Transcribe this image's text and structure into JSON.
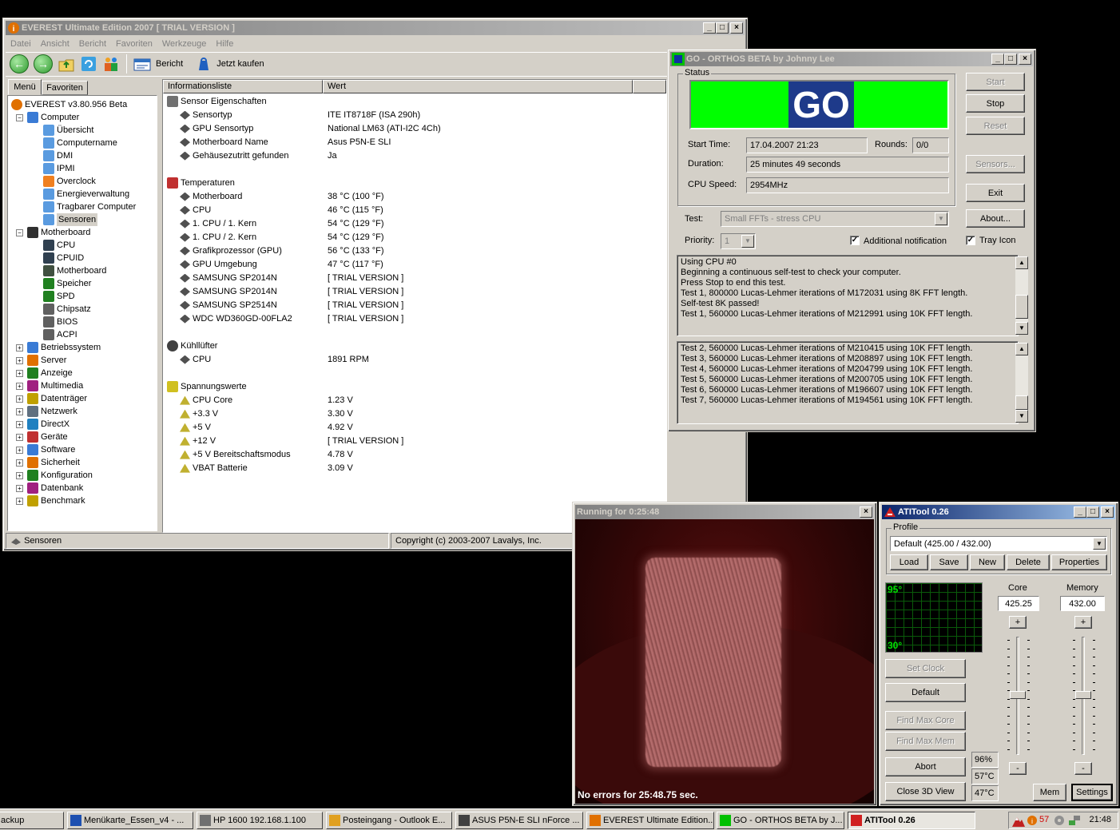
{
  "everest": {
    "title": "EVEREST Ultimate Edition 2007  [ TRIAL VERSION ]",
    "menu": [
      "Datei",
      "Ansicht",
      "Bericht",
      "Favoriten",
      "Werkzeuge",
      "Hilfe"
    ],
    "toolbar": {
      "report": "Bericht",
      "buy": "Jetzt kaufen"
    },
    "tabs": {
      "menu": "Menü",
      "favorites": "Favoriten"
    },
    "tree": {
      "root": "EVEREST v3.80.956 Beta",
      "computer": "Computer",
      "computer_items": [
        "Übersicht",
        "Computername",
        "DMI",
        "IPMI",
        "Overclock",
        "Energieverwaltung",
        "Tragbarer Computer",
        "Sensoren"
      ],
      "motherboard": "Motherboard",
      "motherboard_items": [
        "CPU",
        "CPUID",
        "Motherboard",
        "Speicher",
        "SPD",
        "Chipsatz",
        "BIOS",
        "ACPI"
      ],
      "other_items": [
        "Betriebssystem",
        "Server",
        "Anzeige",
        "Multimedia",
        "Datenträger",
        "Netzwerk",
        "DirectX",
        "Geräte",
        "Software",
        "Sicherheit",
        "Konfiguration",
        "Datenbank",
        "Benchmark"
      ]
    },
    "columns": {
      "field": "Informationsliste",
      "value": "Wert"
    },
    "sections": {
      "sensor": {
        "title": "Sensor Eigenschaften",
        "rows": [
          {
            "field": "Sensortyp",
            "value": "ITE IT8718F  (ISA 290h)"
          },
          {
            "field": "GPU Sensortyp",
            "value": "National LM63  (ATI-I2C 4Ch)"
          },
          {
            "field": "Motherboard Name",
            "value": "Asus P5N-E SLI"
          },
          {
            "field": "Gehäusezutritt gefunden",
            "value": "Ja"
          }
        ]
      },
      "temps": {
        "title": "Temperaturen",
        "rows": [
          {
            "field": "Motherboard",
            "value": "38 °C  (100 °F)"
          },
          {
            "field": "CPU",
            "value": "46 °C  (115 °F)"
          },
          {
            "field": "1. CPU / 1. Kern",
            "value": "54 °C  (129 °F)"
          },
          {
            "field": "1. CPU / 2. Kern",
            "value": "54 °C  (129 °F)"
          },
          {
            "field": "Grafikprozessor (GPU)",
            "value": "56 °C  (133 °F)"
          },
          {
            "field": "GPU Umgebung",
            "value": "47 °C  (117 °F)"
          },
          {
            "field": "SAMSUNG SP2014N",
            "value": "[ TRIAL VERSION ]"
          },
          {
            "field": "SAMSUNG SP2014N",
            "value": "[ TRIAL VERSION ]"
          },
          {
            "field": "SAMSUNG SP2514N",
            "value": "[ TRIAL VERSION ]"
          },
          {
            "field": "WDC WD360GD-00FLA2",
            "value": "[ TRIAL VERSION ]"
          }
        ]
      },
      "fans": {
        "title": "Kühllüfter",
        "rows": [
          {
            "field": "CPU",
            "value": "1891 RPM"
          }
        ]
      },
      "volts": {
        "title": "Spannungswerte",
        "rows": [
          {
            "field": "CPU Core",
            "value": "1.23 V"
          },
          {
            "field": "+3.3 V",
            "value": "3.30 V"
          },
          {
            "field": "+5 V",
            "value": "4.92 V"
          },
          {
            "field": "+12 V",
            "value": "[ TRIAL VERSION ]"
          },
          {
            "field": "+5 V Bereitschaftsmodus",
            "value": "4.78 V"
          },
          {
            "field": "VBAT Batterie",
            "value": "3.09 V"
          }
        ]
      }
    },
    "statusbar": {
      "left": "Sensoren",
      "right": "Copyright (c) 2003-2007 Lavalys, Inc."
    }
  },
  "orthos": {
    "title": "GO - ORTHOS BETA by Johnny Lee",
    "status_label": "Status",
    "go_text": "GO",
    "start_time_label": "Start Time:",
    "start_time": "17.04.2007 21:23",
    "rounds_label": "Rounds:",
    "rounds": "0/0",
    "duration_label": "Duration:",
    "duration": "25 minutes 49 seconds",
    "cpu_speed_label": "CPU Speed:",
    "cpu_speed": "2954MHz",
    "test_label": "Test:",
    "test_value": "Small FFTs - stress CPU",
    "priority_label": "Priority:",
    "priority_value": "1",
    "notify_label": "Additional notification",
    "tray_label": "Tray Icon",
    "buttons": {
      "start": "Start",
      "stop": "Stop",
      "reset": "Reset",
      "sensors": "Sensors...",
      "exit": "Exit",
      "about": "About..."
    },
    "log1": [
      "Using CPU #0",
      "Beginning a continuous self-test to check your computer.",
      "Press Stop to end this test.",
      "Test 1, 800000 Lucas-Lehmer iterations of M172031 using 8K FFT length.",
      "Self-test 8K passed!",
      "Test 1, 560000 Lucas-Lehmer iterations of M212991 using 10K FFT length."
    ],
    "log2": [
      "Test 2, 560000 Lucas-Lehmer iterations of M210415 using 10K FFT length.",
      "Test 3, 560000 Lucas-Lehmer iterations of M208897 using 10K FFT length.",
      "Test 4, 560000 Lucas-Lehmer iterations of M204799 using 10K FFT length.",
      "Test 5, 560000 Lucas-Lehmer iterations of M200705 using 10K FFT length.",
      "Test 6, 560000 Lucas-Lehmer iterations of M196607 using 10K FFT length.",
      "Test 7, 560000 Lucas-Lehmer iterations of M194561 using 10K FFT length."
    ]
  },
  "render3d": {
    "title": "Running for 0:25:48",
    "status": "No errors for 25:48.75 sec."
  },
  "atitool": {
    "title": "ATITool 0.26",
    "profile_label": "Profile",
    "profile_value": "Default (425.00 / 432.00)",
    "profile_buttons": [
      "Load",
      "Save",
      "New",
      "Delete",
      "Properties"
    ],
    "graph_top": "95°",
    "graph_bottom": "30°",
    "core_label": "Core",
    "core_value": "425.25",
    "memory_label": "Memory",
    "memory_value": "432.00",
    "plus": "+",
    "minus": "-",
    "buttons": {
      "set_clock": "Set Clock",
      "default": "Default",
      "find_max_core": "Find Max Core",
      "find_max_mem": "Find Max Mem",
      "abort": "Abort",
      "close3d": "Close 3D View",
      "mem": "Mem",
      "settings": "Settings"
    },
    "readouts": [
      "96%",
      "57°C",
      "47°C"
    ]
  },
  "taskbar": {
    "items": [
      "ackup",
      "Menükarte_Essen_v4 - ...",
      "HP 1600 192.168.1.100",
      "Posteingang - Outlook E...",
      "ASUS P5N-E SLI nForce ...",
      "EVEREST Ultimate Edition...",
      "GO - ORTHOS BETA by J...",
      "ATITool 0.26"
    ],
    "tray_temp": "57",
    "clock": "21:48"
  }
}
